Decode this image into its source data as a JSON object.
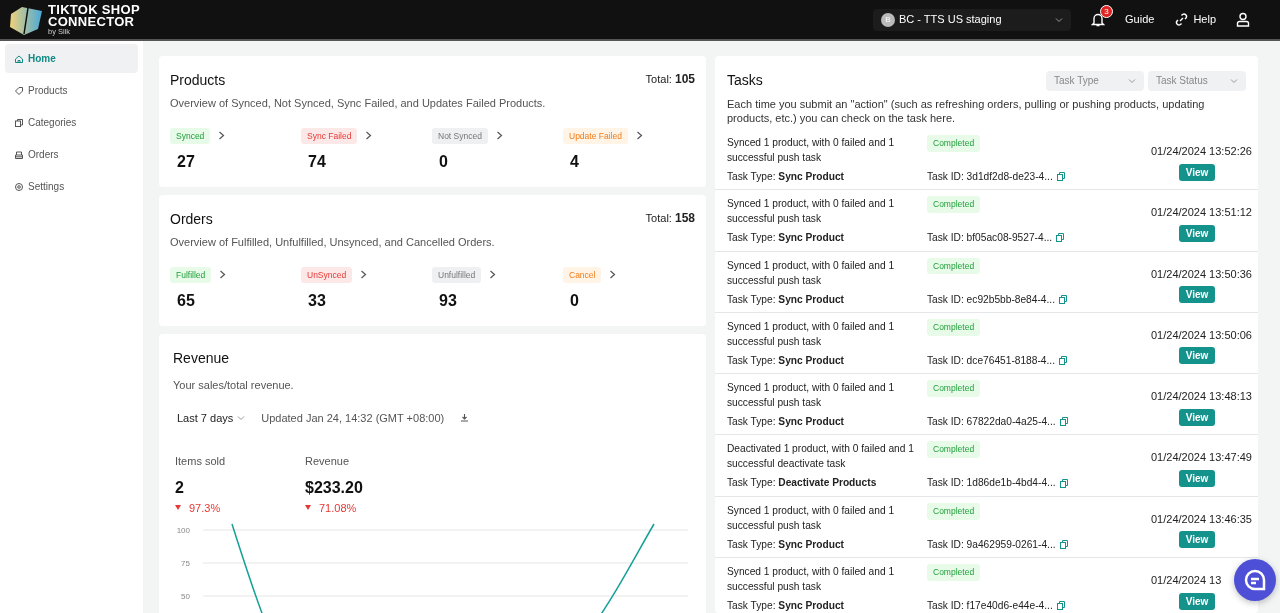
{
  "header": {
    "logo_lines": [
      "TIKTOK SHOP",
      "CONNECTOR"
    ],
    "logo_byline": "by Silk",
    "store_select": {
      "avatar": "B",
      "value": "BC - TTS US staging"
    },
    "notifications": {
      "count": "3"
    },
    "links": [
      "Guide",
      "Help"
    ]
  },
  "sidebar": {
    "items": [
      {
        "label": "Home",
        "selected": true
      },
      {
        "label": "Products",
        "selected": false
      },
      {
        "label": "Categories",
        "selected": false
      },
      {
        "label": "Orders",
        "selected": false
      },
      {
        "label": "Settings",
        "selected": false
      }
    ]
  },
  "summary_cards": [
    {
      "title": "Products",
      "total_label": "Total:",
      "total": "105",
      "description": "Overview of Synced, Not Synced, Sync Failed, and Updates Failed Products.",
      "stats": [
        {
          "label": "Synced",
          "kind": "success",
          "value": "27"
        },
        {
          "label": "Sync Failed",
          "kind": "danger",
          "value": "74"
        },
        {
          "label": "Not Synced",
          "kind": "neutral",
          "value": "0"
        },
        {
          "label": "Update Failed",
          "kind": "warning",
          "value": "4"
        }
      ]
    },
    {
      "title": "Orders",
      "total_label": "Total:",
      "total": "158",
      "description": "Overview of Fulfilled, Unfulfilled, Unsynced, and Cancelled Orders.",
      "stats": [
        {
          "label": "Fulfilled",
          "kind": "success",
          "value": "65"
        },
        {
          "label": "UnSynced",
          "kind": "danger",
          "value": "33"
        },
        {
          "label": "Unfulfilled",
          "kind": "neutral",
          "value": "93"
        },
        {
          "label": "Cancel",
          "kind": "warning",
          "value": "0"
        }
      ]
    }
  ],
  "revenue": {
    "title": "Revenue",
    "description": "Your sales/total revenue.",
    "period": "Last 7 days",
    "updated": "Updated Jan 24, 14:32 (GMT +08:00)",
    "metrics": [
      {
        "label": "Items sold",
        "value": "2",
        "change": "97.3%",
        "decrease": true
      },
      {
        "label": "Revenue",
        "value": "$233.20",
        "change": "71.08%",
        "decrease": true
      }
    ],
    "axis_labels": [
      "100",
      "75",
      "50"
    ]
  },
  "tasks": {
    "title": "Tasks",
    "filters": [
      {
        "placeholder": "Task Type"
      },
      {
        "placeholder": "Task Status"
      }
    ],
    "description": "Each time you submit an \"action\" (such as refreshing orders, pulling or pushing products, updating products, etc.) you can check on the task here.",
    "rows": [
      {
        "summary": "Synced 1 product, with 0 failed and 1 successful push task",
        "status": "Completed",
        "type_label": "Task Type:",
        "type": "Sync Product",
        "id_label": "Task ID:",
        "id": "3d1df2d8-de23-4...",
        "time": "01/24/2024 13:52:26",
        "action": "View"
      },
      {
        "summary": "Synced 1 product, with 0 failed and 1 successful push task",
        "status": "Completed",
        "type_label": "Task Type:",
        "type": "Sync Product",
        "id_label": "Task ID:",
        "id": "bf05ac08-9527-4...",
        "time": "01/24/2024 13:51:12",
        "action": "View"
      },
      {
        "summary": "Synced 1 product, with 0 failed and 1 successful push task",
        "status": "Completed",
        "type_label": "Task Type:",
        "type": "Sync Product",
        "id_label": "Task ID:",
        "id": "ec92b5bb-8e84-4...",
        "time": "01/24/2024 13:50:36",
        "action": "View"
      },
      {
        "summary": "Synced 1 product, with 0 failed and 1 successful push task",
        "status": "Completed",
        "type_label": "Task Type:",
        "type": "Sync Product",
        "id_label": "Task ID:",
        "id": "dce76451-8188-4...",
        "time": "01/24/2024 13:50:06",
        "action": "View"
      },
      {
        "summary": "Synced 1 product, with 0 failed and 1 successful push task",
        "status": "Completed",
        "type_label": "Task Type:",
        "type": "Sync Product",
        "id_label": "Task ID:",
        "id": "67822da0-4a25-4...",
        "time": "01/24/2024 13:48:13",
        "action": "View"
      },
      {
        "summary": "Deactivated 1 product, with 0 failed and 1 successful deactivate task",
        "status": "Completed",
        "type_label": "Task Type:",
        "type": "Deactivate Products",
        "id_label": "Task ID:",
        "id": "1d86de1b-4bd4-4...",
        "time": "01/24/2024 13:47:49",
        "action": "View"
      },
      {
        "summary": "Synced 1 product, with 0 failed and 1 successful push task",
        "status": "Completed",
        "type_label": "Task Type:",
        "type": "Sync Product",
        "id_label": "Task ID:",
        "id": "9a462959-0261-4...",
        "time": "01/24/2024 13:46:35",
        "action": "View"
      },
      {
        "summary": "Synced 1 product, with 0 failed and 1 successful push task",
        "status": "Completed",
        "type_label": "Task Type:",
        "type": "Sync Product",
        "id_label": "Task ID:",
        "id": "f17e40d6-e44e-4...",
        "time": "01/24/2024 13",
        "action": "View"
      }
    ]
  }
}
